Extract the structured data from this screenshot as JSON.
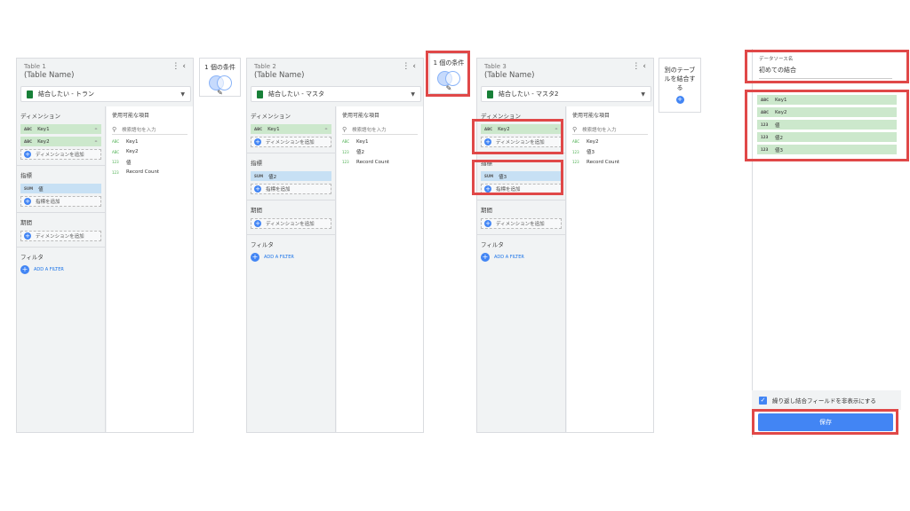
{
  "panels": [
    {
      "label": "Table 1",
      "name": "(Table Name)",
      "source": "結合したい - トラン",
      "dimension_title": "ディメンション",
      "dimensions": [
        {
          "type": "ABC",
          "name": "Key1",
          "linked": true
        },
        {
          "type": "ABC",
          "name": "Key2",
          "linked": true
        }
      ],
      "add_dimension": "ディメンションを追加",
      "metric_title": "指標",
      "metrics": [
        {
          "type": "SUM",
          "name": "値"
        }
      ],
      "add_metric": "指標を追加",
      "period_title": "期間",
      "add_period": "ディメンションを追加",
      "filter_title": "フィルタ",
      "add_filter": "ADD A FILTER",
      "available_title": "使用可能な項目",
      "search_placeholder": "検索語句を入力",
      "available_fields": [
        {
          "type": "ABC",
          "name": "Key1"
        },
        {
          "type": "ABC",
          "name": "Key2"
        },
        {
          "type": "123",
          "name": "値"
        },
        {
          "type": "123",
          "name": "Record Count"
        }
      ]
    },
    {
      "label": "Table 2",
      "name": "(Table Name)",
      "source": "結合したい - マスタ",
      "dimension_title": "ディメンション",
      "dimensions": [
        {
          "type": "ABC",
          "name": "Key1",
          "linked": true
        }
      ],
      "add_dimension": "ディメンションを追加",
      "metric_title": "指標",
      "metrics": [
        {
          "type": "SUM",
          "name": "値2"
        }
      ],
      "add_metric": "指標を追加",
      "period_title": "期間",
      "add_period": "ディメンションを追加",
      "filter_title": "フィルタ",
      "add_filter": "ADD A FILTER",
      "available_title": "使用可能な項目",
      "search_placeholder": "検索語句を入力",
      "available_fields": [
        {
          "type": "ABC",
          "name": "Key1"
        },
        {
          "type": "123",
          "name": "値2"
        },
        {
          "type": "123",
          "name": "Record Count"
        }
      ]
    },
    {
      "label": "Table 3",
      "name": "(Table Name)",
      "source": "結合したい - マスタ2",
      "dimension_title": "ディメンション",
      "dimensions": [
        {
          "type": "ABC",
          "name": "Key2",
          "linked": true
        }
      ],
      "add_dimension": "ディメンションを追加",
      "metric_title": "指標",
      "metrics": [
        {
          "type": "SUM",
          "name": "値3"
        }
      ],
      "add_metric": "指標を追加",
      "period_title": "期間",
      "add_period": "ディメンションを追加",
      "filter_title": "フィルタ",
      "add_filter": "ADD A FILTER",
      "available_title": "使用可能な項目",
      "search_placeholder": "検索語句を入力",
      "available_fields": [
        {
          "type": "ABC",
          "name": "Key2"
        },
        {
          "type": "123",
          "name": "値3"
        },
        {
          "type": "123",
          "name": "Record Count"
        }
      ]
    }
  ],
  "joins": [
    {
      "label": "1 個の条件"
    },
    {
      "label": "1 個の条件"
    }
  ],
  "add_table": {
    "label": "別のテーブルを結合する"
  },
  "right_panel": {
    "source_label": "データソース名",
    "source_value": "初めての結合",
    "fields": [
      {
        "type": "ABC",
        "name": "Key1"
      },
      {
        "type": "ABC",
        "name": "Key2"
      },
      {
        "type": "123",
        "name": "値"
      },
      {
        "type": "123",
        "name": "値2"
      },
      {
        "type": "123",
        "name": "値3"
      }
    ],
    "hide_repeated_label": "繰り返し結合フィールドを非表示にする",
    "save_label": "保存"
  },
  "icons": {
    "sheet": "sheets-icon",
    "link": "link-icon",
    "search": "search-icon",
    "add": "add-circle-icon",
    "more": "more-vert-icon",
    "collapse": "chevron-left-icon",
    "edit": "pencil-icon",
    "dropdown": "caret-down-icon",
    "check": "checkbox-checked-icon"
  },
  "colors": {
    "accent": "#4285f4",
    "dimension_chip": "#cce8cc",
    "metric_chip": "#c7e0f4",
    "highlight": "#e04848",
    "sheets_green": "#188038"
  }
}
